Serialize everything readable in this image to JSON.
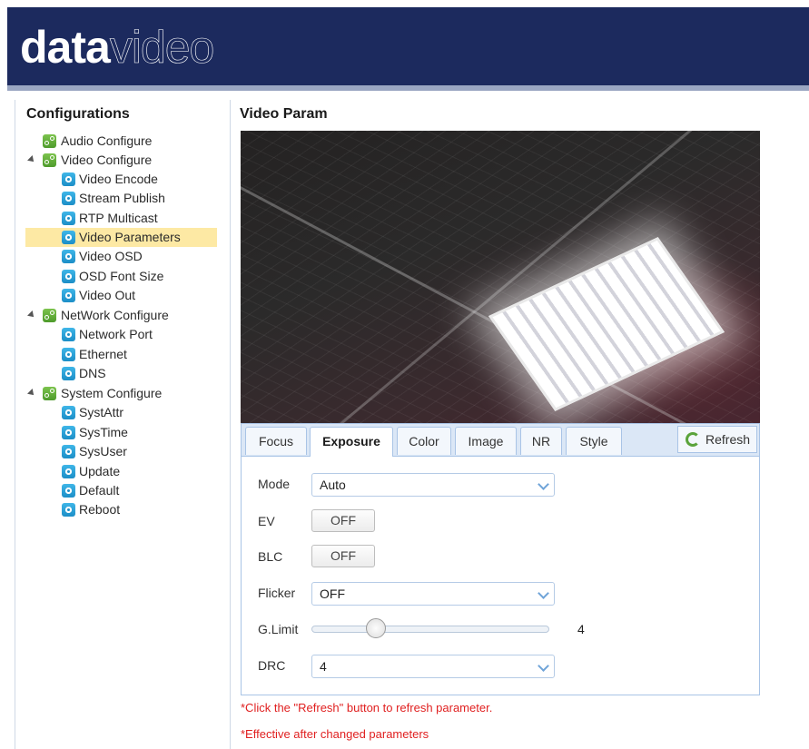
{
  "brand": {
    "logo_bold": "data",
    "logo_thin": "video"
  },
  "sidebar": {
    "title": "Configurations",
    "groups": [
      {
        "label": "Audio Configure",
        "expandable": false,
        "items": []
      },
      {
        "label": "Video Configure",
        "expandable": true,
        "items": [
          "Video Encode",
          "Stream Publish",
          "RTP Multicast",
          "Video Parameters",
          "Video OSD",
          "OSD Font Size",
          "Video Out"
        ]
      },
      {
        "label": "NetWork Configure",
        "expandable": true,
        "items": [
          "Network Port",
          "Ethernet",
          "DNS"
        ]
      },
      {
        "label": "System Configure",
        "expandable": true,
        "items": [
          "SystAttr",
          "SysTime",
          "SysUser",
          "Update",
          "Default",
          "Reboot"
        ]
      }
    ],
    "selected": "Video Parameters"
  },
  "main": {
    "title": "Video Param",
    "tabs": [
      "Focus",
      "Exposure",
      "Color",
      "Image",
      "NR",
      "Style"
    ],
    "active_tab": "Exposure",
    "refresh_label": "Refresh",
    "form": {
      "mode": {
        "label": "Mode",
        "value": "Auto"
      },
      "ev": {
        "label": "EV",
        "value": "OFF"
      },
      "blc": {
        "label": "BLC",
        "value": "OFF"
      },
      "flicker": {
        "label": "Flicker",
        "value": "OFF"
      },
      "glimit": {
        "label": "G.Limit",
        "value": "4",
        "fraction": 0.27
      },
      "drc": {
        "label": "DRC",
        "value": "4"
      }
    },
    "notes": [
      "*Click the \"Refresh\" button to refresh parameter.",
      "*Effective after changed parameters"
    ]
  },
  "colors": {
    "header": "#1c2a5e",
    "note": "#e02020",
    "selected_bg": "#fde9a4"
  }
}
